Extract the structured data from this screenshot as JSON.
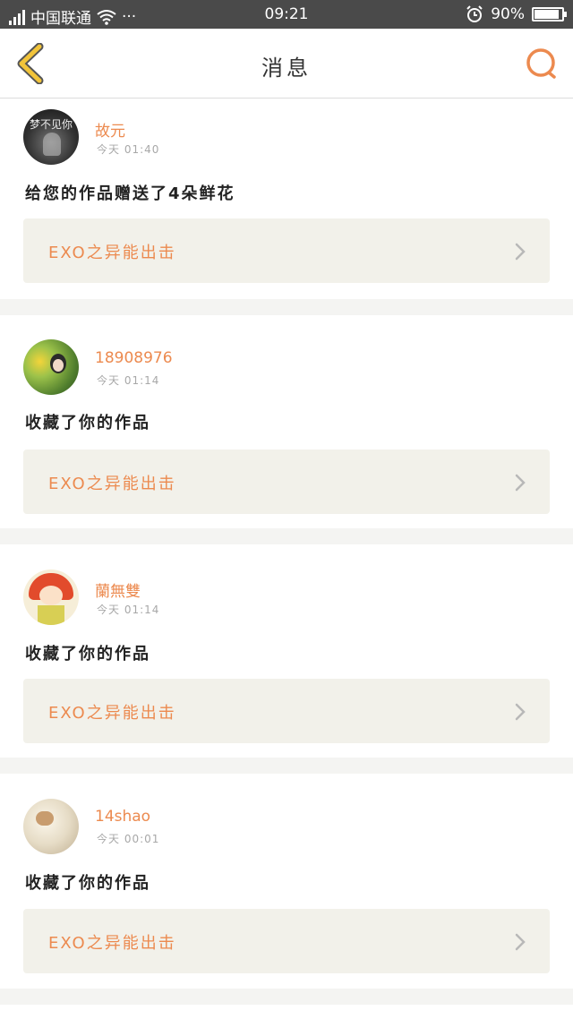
{
  "status_bar": {
    "carrier": "中国联通",
    "more": "···",
    "time": "09:21",
    "battery_text": "90%",
    "battery_level": 0.9
  },
  "nav": {
    "title": "消息",
    "back_icon": "chevron-left-icon",
    "search_icon": "search-icon",
    "accent": "#ec8a4f",
    "back_color": "#f2c43a"
  },
  "messages": [
    {
      "username": "故元",
      "time": "今天 01:40",
      "text": "给您的作品赠送了4朵鲜花",
      "work_title": "EXO之异能出击",
      "avatar_text": "梦不见你"
    },
    {
      "username": "18908976",
      "time": "今天 01:14",
      "text": "收藏了你的作品",
      "work_title": "EXO之异能出击",
      "avatar_text": ""
    },
    {
      "username": "蘭無雙",
      "time": "今天 01:14",
      "text": "收藏了你的作品",
      "work_title": "EXO之异能出击",
      "avatar_text": ""
    },
    {
      "username": "14shao",
      "time": "今天 00:01",
      "text": "收藏了你的作品",
      "work_title": "EXO之异能出击",
      "avatar_text": ""
    }
  ]
}
